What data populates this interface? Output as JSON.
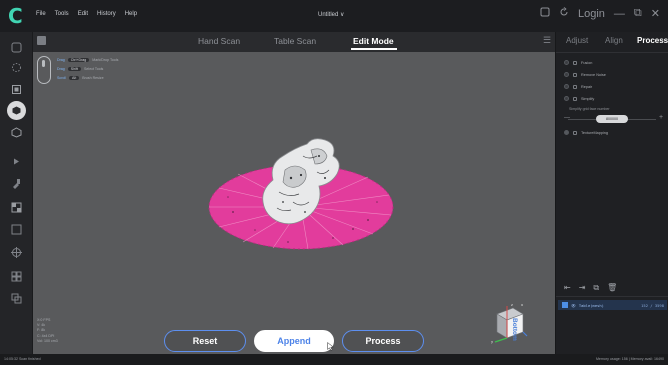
{
  "titlebar": {
    "menu": [
      "File",
      "Tools",
      "Edit",
      "History",
      "Help"
    ],
    "doc_title": "Untitled ∨",
    "login_label": "Login",
    "minimize": "—",
    "maximize": "⧉",
    "close": "✕"
  },
  "modebar": {
    "tabs": [
      {
        "label": "Hand Scan",
        "active": false
      },
      {
        "label": "Table Scan",
        "active": false
      },
      {
        "label": "Edit Mode",
        "active": true
      }
    ]
  },
  "mouse_help": {
    "rows": [
      {
        "action": "Drag",
        "key": "Ctrl+Drag",
        "desc": "Mark/Drop Tools"
      },
      {
        "action": "Drag",
        "key": "Shift",
        "desc": "Select Tools"
      },
      {
        "action": "Scroll",
        "key": "Alt",
        "desc": "Brush Resize"
      }
    ]
  },
  "stats": {
    "lines": [
      "X:0 FPS",
      "V: 4k",
      "F: 8k",
      "C: 4x4 DPI",
      "Vol: 100 cm3"
    ]
  },
  "actions": {
    "reset_label": "Reset",
    "append_label": "Append",
    "process_label": "Process"
  },
  "gizmo": {
    "face_label": "Bottom"
  },
  "right_panel": {
    "tabs": [
      {
        "label": "Adjust",
        "active": false
      },
      {
        "label": "Align",
        "active": false
      },
      {
        "label": "Process",
        "active": true
      }
    ],
    "steps": [
      "Fusion",
      "Remove Noise",
      "Repair",
      "Simplify"
    ],
    "simplify_label": "Simplify grid face number",
    "simplify_value": "800000",
    "texture_label": "TextureMapping",
    "layer": {
      "name": "Table(mesh)",
      "count": "152 / 3598"
    }
  },
  "statusbar": {
    "left": "14:05:32 Scan finished",
    "right": "Memory usage: 156 | Memory avail: 16490"
  },
  "colors": {
    "accent_blue": "#5d8ff0",
    "logo_teal": "#41d4b2",
    "scan_pink": "#e23c9c"
  }
}
